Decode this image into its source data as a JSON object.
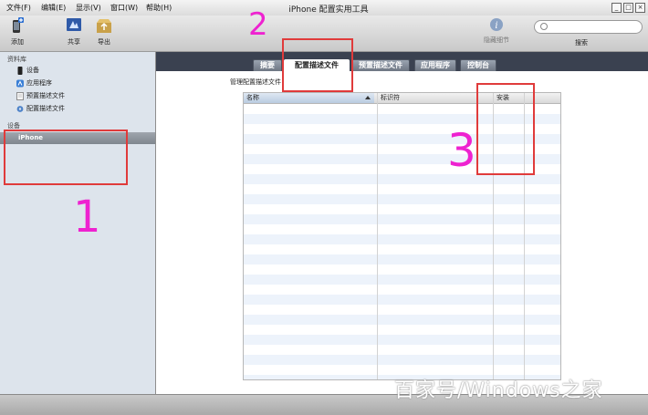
{
  "menu": [
    "文件(F)",
    "编辑(E)",
    "显示(V)",
    "窗口(W)",
    "帮助(H)"
  ],
  "window": {
    "title": "iPhone 配置实用工具",
    "controls": [
      "_",
      "□",
      "×"
    ]
  },
  "toolbar": {
    "add": "添加",
    "share": "共享",
    "export": "导出",
    "hide_details": "隐藏细节",
    "search_label": "搜索",
    "search_placeholder": ""
  },
  "sidebar": {
    "library_header": "资料库",
    "library_items": [
      "设备",
      "应用程序",
      "预置描述文件",
      "配置描述文件"
    ],
    "devices_header": "设备",
    "device_selected": "iPhone"
  },
  "tabs": [
    {
      "label": "摘要",
      "active": false
    },
    {
      "label": "配置描述文件",
      "active": true
    },
    {
      "label": "预置描述文件",
      "active": false
    },
    {
      "label": "应用程序",
      "active": false
    },
    {
      "label": "控制台",
      "active": false
    }
  ],
  "main": {
    "section_title": "管理配置描述文件"
  },
  "table": {
    "columns": [
      "名称",
      "标识符",
      "安装"
    ],
    "sorted_column": "名称"
  },
  "annotations": {
    "n1": "1",
    "n2": "2",
    "n3": "3"
  },
  "watermark": "百家号/Windows之家",
  "colors": {
    "annotation_box": "#e03b3b",
    "annotation_ink": "#ee22d0",
    "tab_bar": "#3a4150",
    "sidebar": "#dde4ec"
  }
}
